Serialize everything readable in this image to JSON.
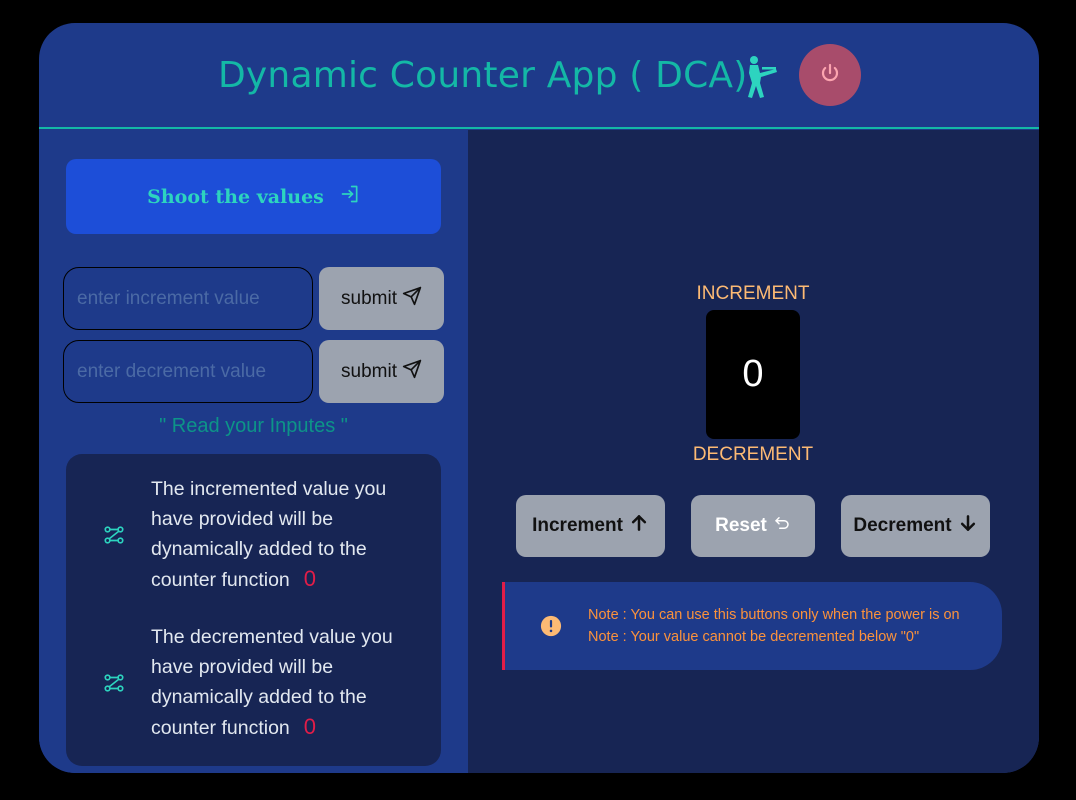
{
  "app": {
    "title": "Dynamic Counter App ( DCA)",
    "soldier_icon": "soldier-shooting-icon",
    "power_icon": "power-icon"
  },
  "left": {
    "shoot_label": "Shoot the values",
    "shoot_icon": "login-arrow-icon",
    "increment_input": {
      "placeholder": "enter increment value",
      "value": ""
    },
    "decrement_input": {
      "placeholder": "enter decrement value",
      "value": ""
    },
    "submit_label": "submit",
    "submit_icon": "send-icon",
    "read_heading": "\" Read your Inputes \"",
    "info": [
      {
        "icon": "flow-icon",
        "text": "The incremented value you have provided will be dynamically added to the counter function",
        "value": "0"
      },
      {
        "icon": "flow-icon",
        "text": "The decremented value you have provided will be dynamically added to the counter function",
        "value": "0"
      }
    ]
  },
  "right": {
    "increment_label": "INCREMENT",
    "decrement_label": "DECREMENT",
    "counter_value": "0",
    "buttons": {
      "increment": "Increment",
      "reset": "Reset",
      "decrement": "Decrement"
    },
    "notes": [
      "Note : You can use this buttons only when the power is on",
      "Note : Your value cannot be decremented below \"0\""
    ]
  },
  "colors": {
    "teal": "#14b8a6",
    "panel_blue": "#1e3a8a",
    "dark_blue": "#172554",
    "accent_red": "#e11d48",
    "orange": "#fdba74"
  }
}
